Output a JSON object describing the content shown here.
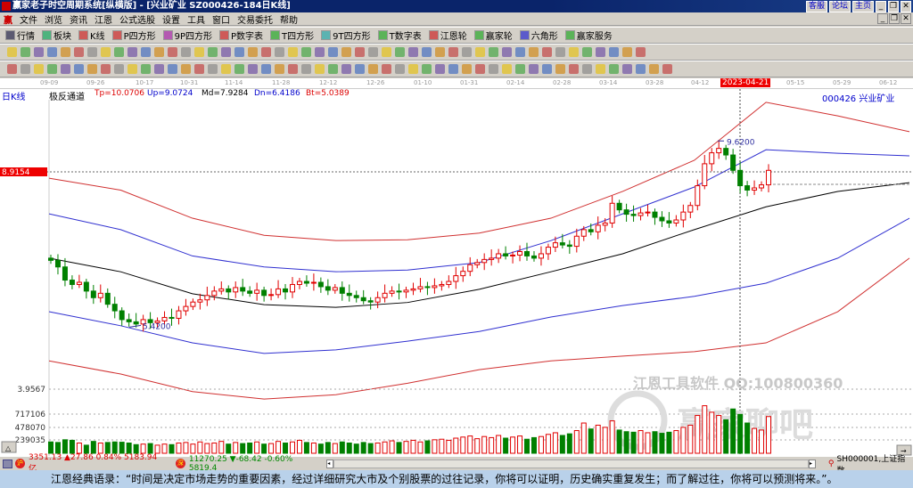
{
  "window": {
    "title": "赢家老子时空周期系统[纵横版] - [兴业矿业   SZ000426-184日K线]",
    "links": [
      "客服",
      "论坛",
      "主页"
    ]
  },
  "menu": [
    "文件",
    "浏览",
    "资讯",
    "江恩",
    "公式选股",
    "设置",
    "工具",
    "窗口",
    "交易委托",
    "帮助"
  ],
  "toolbar": [
    "行情",
    "板块",
    "K线",
    "P四方形",
    "9P四方形",
    "P数字表",
    "T四方形",
    "9T四方形",
    "T数字表",
    "江恩轮",
    "赢家轮",
    "六角形",
    "赢家服务"
  ],
  "dates": [
    "09-09",
    "09-26",
    "10-17",
    "10-31",
    "11-14",
    "11-28",
    "12-12",
    "12-26",
    "01-10",
    "01-31",
    "02-14",
    "02-28",
    "03-14",
    "03-28",
    "04-12",
    "05-15",
    "05-29",
    "06-12"
  ],
  "cursor_date": "2023-04-21",
  "chart_type": "日K线",
  "indicator": {
    "name": "极反通道",
    "tp": "Tp=10.0706",
    "up": "Up=9.0724",
    "md": "Md=7.9284",
    "dn": "Dn=6.4186",
    "bt": "Bt=5.0389"
  },
  "stock": "000426  兴业矿业",
  "price_label": "8.9154",
  "high_label": "9.6200",
  "low_label": "5.4200",
  "vol_labels": [
    "3.9567",
    "717106",
    "478070",
    "239035"
  ],
  "watermark": {
    "line1": "江恩工具软件  QQ:100800360",
    "line2": "赢家聊吧"
  },
  "status": {
    "sh": "3351.13 ▲27.86 0.84% 5183.94亿",
    "sz": "11270.25 ▼-68.42 -0.60% 5819.4",
    "index": "SH000001,上证指数"
  },
  "quote": "江恩经典语录：“时间是决定市场走势的重要因素，经过详细研究大市及个别股票的过往记录，你将可以证明，历史确实重复发生；而了解过往，你将可以预测将来。”。",
  "colors": {
    "up": "#e00000",
    "down": "#008000",
    "band_outer": "#d03030",
    "band_inner": "#3030d0",
    "mid": "#000000"
  },
  "chart_data": {
    "type": "candlestick",
    "closes": [
      6.9,
      6.75,
      6.45,
      6.35,
      6.4,
      6.2,
      6.05,
      6.15,
      5.9,
      5.75,
      5.55,
      5.5,
      5.45,
      5.55,
      5.48,
      5.52,
      5.6,
      5.58,
      5.75,
      5.85,
      5.95,
      6.0,
      6.1,
      6.2,
      6.25,
      6.18,
      6.28,
      6.2,
      6.15,
      6.22,
      6.1,
      6.12,
      6.25,
      6.18,
      6.35,
      6.42,
      6.38,
      6.4,
      6.3,
      6.22,
      6.28,
      6.15,
      6.1,
      6.05,
      5.98,
      5.95,
      6.05,
      6.15,
      6.2,
      6.18,
      6.22,
      6.25,
      6.3,
      6.28,
      6.32,
      6.35,
      6.42,
      6.55,
      6.65,
      6.8,
      6.85,
      6.92,
      6.95,
      7.05,
      7.0,
      7.02,
      7.1,
      7.0,
      6.95,
      7.05,
      7.2,
      7.3,
      7.25,
      7.22,
      7.45,
      7.6,
      7.55,
      7.7,
      7.75,
      8.2,
      8.05,
      7.95,
      7.92,
      7.98,
      8.0,
      7.88,
      7.8,
      7.75,
      7.82,
      8.0,
      8.15,
      8.6,
      9.1,
      9.35,
      9.45,
      9.3,
      8.95,
      8.6,
      8.5,
      8.55,
      8.62,
      8.95
    ],
    "volumes": [
      210000,
      200000,
      250000,
      240000,
      190000,
      150000,
      220000,
      190000,
      200000,
      210000,
      205000,
      190000,
      160000,
      170000,
      180000,
      150000,
      170000,
      160000,
      190000,
      200000,
      170000,
      210000,
      180000,
      190000,
      220000,
      170000,
      200000,
      180000,
      190000,
      210000,
      170000,
      180000,
      220000,
      190000,
      210000,
      240000,
      200000,
      190000,
      170000,
      200000,
      180000,
      210000,
      190000,
      170000,
      200000,
      180000,
      190000,
      210000,
      230000,
      200000,
      220000,
      240000,
      210000,
      230000,
      250000,
      260000,
      240000,
      280000,
      300000,
      320000,
      270000,
      310000,
      290000,
      330000,
      280000,
      300000,
      320000,
      260000,
      290000,
      310000,
      350000,
      380000,
      330000,
      360000,
      420000,
      560000,
      450000,
      520000,
      480000,
      600000,
      430000,
      400000,
      390000,
      420000,
      380000,
      400000,
      370000,
      390000,
      420000,
      480000,
      520000,
      700000,
      880000,
      760000,
      700000,
      620000,
      820000,
      720000,
      560000,
      460000,
      430000,
      680000
    ],
    "bands": {
      "tp": [
        8.77,
        8.5,
        7.86,
        7.47,
        7.35,
        7.37,
        7.52,
        7.86,
        8.47,
        9.18,
        10.5,
        10.19,
        9.83
      ],
      "up": [
        7.96,
        7.6,
        7.0,
        6.75,
        6.64,
        6.68,
        6.85,
        7.35,
        7.96,
        8.57,
        9.42,
        9.34,
        9.28
      ],
      "md": [
        6.95,
        6.64,
        6.14,
        5.89,
        5.83,
        5.94,
        6.24,
        6.64,
        7.05,
        7.6,
        8.12,
        8.47,
        8.67
      ],
      "dn": [
        5.73,
        5.41,
        5.02,
        4.78,
        4.86,
        5.06,
        5.28,
        5.61,
        5.87,
        6.08,
        6.38,
        6.95,
        7.86
      ],
      "bt": [
        4.61,
        4.31,
        3.91,
        3.74,
        3.84,
        4.1,
        4.41,
        4.61,
        4.72,
        4.82,
        5.02,
        5.73,
        6.95
      ]
    }
  }
}
